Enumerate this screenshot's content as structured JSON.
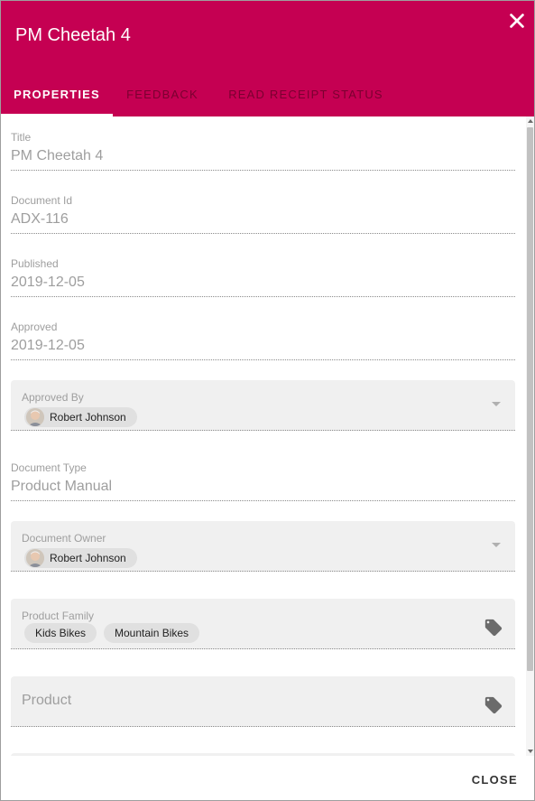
{
  "dialog": {
    "title": "PM Cheetah 4",
    "close_icon": "close-icon"
  },
  "tabs": [
    {
      "label": "PROPERTIES",
      "active": true
    },
    {
      "label": "FEEDBACK",
      "active": false
    },
    {
      "label": "READ RECEIPT STATUS",
      "active": false
    }
  ],
  "fields": {
    "title": {
      "label": "Title",
      "value": "PM Cheetah 4"
    },
    "document_id": {
      "label": "Document Id",
      "value": "ADX-116"
    },
    "published": {
      "label": "Published",
      "value": "2019-12-05"
    },
    "approved": {
      "label": "Approved",
      "value": "2019-12-05"
    },
    "approved_by": {
      "label": "Approved By",
      "chip": "Robert Johnson"
    },
    "document_type": {
      "label": "Document Type",
      "value": "Product Manual"
    },
    "document_owner": {
      "label": "Document Owner",
      "chip": "Robert Johnson"
    },
    "product_family": {
      "label": "Product Family",
      "chips": [
        "Kids Bikes",
        "Mountain Bikes"
      ],
      "icon": "tag-icon"
    },
    "product": {
      "placeholder": "Product",
      "icon": "tag-icon"
    }
  },
  "footer": {
    "close_label": "CLOSE"
  },
  "colors": {
    "header": "#c50052",
    "field_bg": "#f0f0f0",
    "chip_bg": "#e0e0e0"
  }
}
